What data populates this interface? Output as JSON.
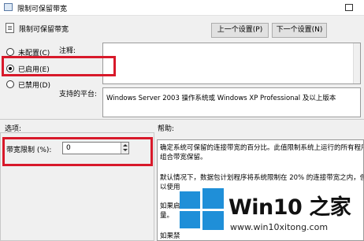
{
  "window": {
    "title": "限制可保留带宽"
  },
  "header": {
    "title": "限制可保留带宽"
  },
  "nav": {
    "prev_label": "上一个设置(P)",
    "next_label": "下一个设置(N)"
  },
  "state": {
    "options": [
      {
        "label": "未配置(C)",
        "selected": false
      },
      {
        "label": "已启用(E)",
        "selected": true
      },
      {
        "label": "已禁用(D)",
        "selected": false
      }
    ]
  },
  "labels": {
    "comment": "注释:",
    "supported_on": "支持的平台:",
    "options": "选项:",
    "help": "帮助:"
  },
  "comment_value": "",
  "supported_value": "Windows Server 2003 操作系统或 Windows XP Professional 及以上版本",
  "bandwidth": {
    "label": "带宽限制 (%):",
    "value": "0"
  },
  "help_text": [
    "确定系统可保留的连接带宽的百分比。此值限制系统上运行的所有程序",
    "组合带宽保留。",
    "默认情况下，数据包计划程序将系统限制在 20% 的连接带宽之内，但",
    "以使用",
    "如果启",
    "量。",
    "如果禁"
  ],
  "watermark": {
    "brand": "Win10 之家",
    "url": "www.win10xitong.com"
  },
  "colors": {
    "highlight_box": "#d8192a",
    "logo_blue": "#1f8fd8"
  }
}
